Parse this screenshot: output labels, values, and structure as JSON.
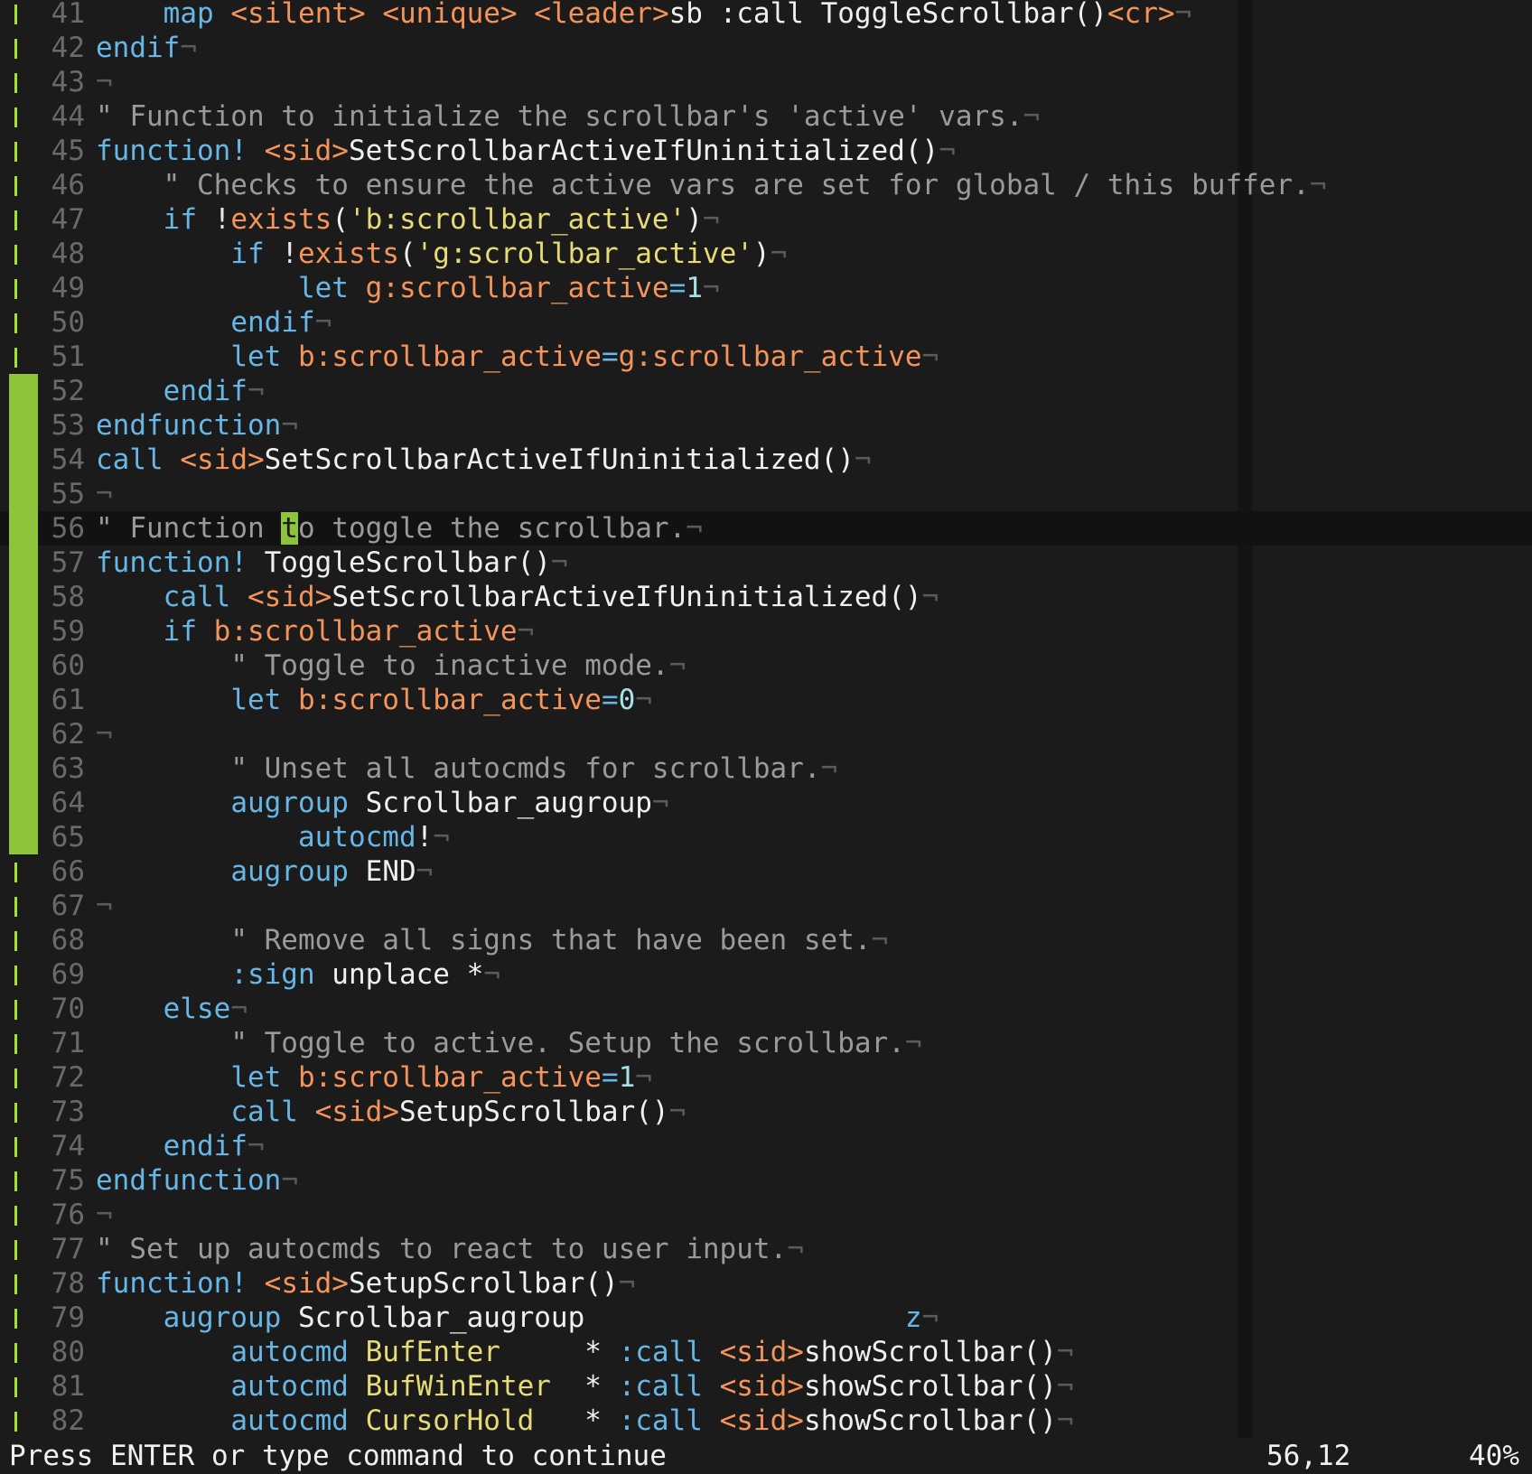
{
  "editor": {
    "lines": [
      {
        "num": "41",
        "sign": "bar",
        "segs": [
          {
            "t": "    "
          },
          {
            "c": "k",
            "t": "map"
          },
          {
            "t": " "
          },
          {
            "c": "v",
            "t": "<silent>"
          },
          {
            "t": " "
          },
          {
            "c": "v",
            "t": "<unique>"
          },
          {
            "t": " "
          },
          {
            "c": "v",
            "t": "<leader>"
          },
          {
            "t": "sb :call ToggleScrollbar()"
          },
          {
            "c": "v",
            "t": "<cr>"
          },
          {
            "c": "eol",
            "t": "¬"
          }
        ]
      },
      {
        "num": "42",
        "sign": "bar",
        "segs": [
          {
            "c": "k",
            "t": "endif"
          },
          {
            "c": "eol",
            "t": "¬"
          }
        ]
      },
      {
        "num": "43",
        "sign": "bar",
        "segs": [
          {
            "c": "eol",
            "t": "¬"
          }
        ]
      },
      {
        "num": "44",
        "sign": "bar",
        "segs": [
          {
            "c": "c",
            "t": "\" Function to initialize the scrollbar's 'active' vars."
          },
          {
            "c": "eol",
            "t": "¬"
          }
        ]
      },
      {
        "num": "45",
        "sign": "bar",
        "segs": [
          {
            "c": "k",
            "t": "function!"
          },
          {
            "t": " "
          },
          {
            "c": "v",
            "t": "<sid>"
          },
          {
            "t": "SetScrollbarActiveIfUninitialized()"
          },
          {
            "c": "eol",
            "t": "¬"
          }
        ]
      },
      {
        "num": "46",
        "sign": "bar",
        "segs": [
          {
            "t": "    "
          },
          {
            "c": "c",
            "t": "\" Checks to ensure the active vars are set for global / this buffer."
          },
          {
            "c": "eol",
            "t": "¬"
          }
        ]
      },
      {
        "num": "47",
        "sign": "bar",
        "segs": [
          {
            "t": "    "
          },
          {
            "c": "k",
            "t": "if"
          },
          {
            "t": " "
          },
          {
            "c": "o",
            "t": "!"
          },
          {
            "c": "v",
            "t": "exists"
          },
          {
            "t": "("
          },
          {
            "c": "s",
            "t": "'b:scrollbar_active'"
          },
          {
            "t": ")"
          },
          {
            "c": "eol",
            "t": "¬"
          }
        ]
      },
      {
        "num": "48",
        "sign": "bar",
        "segs": [
          {
            "t": "        "
          },
          {
            "c": "k",
            "t": "if"
          },
          {
            "t": " "
          },
          {
            "c": "o",
            "t": "!"
          },
          {
            "c": "v",
            "t": "exists"
          },
          {
            "t": "("
          },
          {
            "c": "s",
            "t": "'g:scrollbar_active'"
          },
          {
            "t": ")"
          },
          {
            "c": "eol",
            "t": "¬"
          }
        ]
      },
      {
        "num": "49",
        "sign": "bar",
        "segs": [
          {
            "t": "            "
          },
          {
            "c": "k",
            "t": "let"
          },
          {
            "t": " "
          },
          {
            "c": "v",
            "t": "g:scrollbar_active"
          },
          {
            "c": "k",
            "t": "="
          },
          {
            "c": "n",
            "t": "1"
          },
          {
            "c": "eol",
            "t": "¬"
          }
        ]
      },
      {
        "num": "50",
        "sign": "bar",
        "segs": [
          {
            "t": "        "
          },
          {
            "c": "k",
            "t": "endif"
          },
          {
            "c": "eol",
            "t": "¬"
          }
        ]
      },
      {
        "num": "51",
        "sign": "bar",
        "segs": [
          {
            "t": "        "
          },
          {
            "c": "k",
            "t": "let"
          },
          {
            "t": " "
          },
          {
            "c": "v",
            "t": "b:scrollbar_active"
          },
          {
            "c": "k",
            "t": "="
          },
          {
            "c": "v",
            "t": "g:scrollbar_active"
          },
          {
            "c": "eol",
            "t": "¬"
          }
        ]
      },
      {
        "num": "52",
        "sign": "block",
        "segs": [
          {
            "t": "    "
          },
          {
            "c": "k",
            "t": "endif"
          },
          {
            "c": "eol",
            "t": "¬"
          }
        ]
      },
      {
        "num": "53",
        "sign": "block",
        "segs": [
          {
            "c": "k",
            "t": "endfunction"
          },
          {
            "c": "eol",
            "t": "¬"
          }
        ]
      },
      {
        "num": "54",
        "sign": "block",
        "segs": [
          {
            "c": "k",
            "t": "call"
          },
          {
            "t": " "
          },
          {
            "c": "v",
            "t": "<sid>"
          },
          {
            "t": "SetScrollbarActiveIfUninitialized()"
          },
          {
            "c": "eol",
            "t": "¬"
          }
        ]
      },
      {
        "num": "55",
        "sign": "block",
        "segs": [
          {
            "c": "eol",
            "t": "¬"
          }
        ]
      },
      {
        "num": "56",
        "sign": "block",
        "cursorline": true,
        "segs": [
          {
            "c": "c",
            "t": "\" Function "
          },
          {
            "c": "cur",
            "t": "t"
          },
          {
            "c": "c",
            "t": "o toggle the scrollbar."
          },
          {
            "c": "eol",
            "t": "¬"
          }
        ]
      },
      {
        "num": "57",
        "sign": "block",
        "segs": [
          {
            "c": "k",
            "t": "function!"
          },
          {
            "t": " ToggleScrollbar()"
          },
          {
            "c": "eol",
            "t": "¬"
          }
        ]
      },
      {
        "num": "58",
        "sign": "block",
        "segs": [
          {
            "t": "    "
          },
          {
            "c": "k",
            "t": "call"
          },
          {
            "t": " "
          },
          {
            "c": "v",
            "t": "<sid>"
          },
          {
            "t": "SetScrollbarActiveIfUninitialized()"
          },
          {
            "c": "eol",
            "t": "¬"
          }
        ]
      },
      {
        "num": "59",
        "sign": "block",
        "segs": [
          {
            "t": "    "
          },
          {
            "c": "k",
            "t": "if"
          },
          {
            "t": " "
          },
          {
            "c": "v",
            "t": "b:scrollbar_active"
          },
          {
            "c": "eol",
            "t": "¬"
          }
        ]
      },
      {
        "num": "60",
        "sign": "block",
        "segs": [
          {
            "t": "        "
          },
          {
            "c": "c",
            "t": "\" Toggle to inactive mode."
          },
          {
            "c": "eol",
            "t": "¬"
          }
        ]
      },
      {
        "num": "61",
        "sign": "block",
        "segs": [
          {
            "t": "        "
          },
          {
            "c": "k",
            "t": "let"
          },
          {
            "t": " "
          },
          {
            "c": "v",
            "t": "b:scrollbar_active"
          },
          {
            "c": "k",
            "t": "="
          },
          {
            "c": "n",
            "t": "0"
          },
          {
            "c": "eol",
            "t": "¬"
          }
        ]
      },
      {
        "num": "62",
        "sign": "block",
        "segs": [
          {
            "c": "eol",
            "t": "¬"
          }
        ]
      },
      {
        "num": "63",
        "sign": "block",
        "segs": [
          {
            "t": "        "
          },
          {
            "c": "c",
            "t": "\" Unset all autocmds for scrollbar."
          },
          {
            "c": "eol",
            "t": "¬"
          }
        ]
      },
      {
        "num": "64",
        "sign": "block",
        "segs": [
          {
            "t": "        "
          },
          {
            "c": "k",
            "t": "augroup"
          },
          {
            "t": " Scrollbar_augroup"
          },
          {
            "c": "eol",
            "t": "¬"
          }
        ]
      },
      {
        "num": "65",
        "sign": "block",
        "segs": [
          {
            "t": "            "
          },
          {
            "c": "k",
            "t": "autocmd"
          },
          {
            "t": "!"
          },
          {
            "c": "eol",
            "t": "¬"
          }
        ]
      },
      {
        "num": "66",
        "sign": "bar",
        "segs": [
          {
            "t": "        "
          },
          {
            "c": "k",
            "t": "augroup"
          },
          {
            "t": " END"
          },
          {
            "c": "eol",
            "t": "¬"
          }
        ]
      },
      {
        "num": "67",
        "sign": "bar",
        "segs": [
          {
            "c": "eol",
            "t": "¬"
          }
        ]
      },
      {
        "num": "68",
        "sign": "bar",
        "segs": [
          {
            "t": "        "
          },
          {
            "c": "c",
            "t": "\" Remove all signs that have been set."
          },
          {
            "c": "eol",
            "t": "¬"
          }
        ]
      },
      {
        "num": "69",
        "sign": "bar",
        "segs": [
          {
            "t": "        "
          },
          {
            "c": "k",
            "t": ":sign"
          },
          {
            "t": " unplace *"
          },
          {
            "c": "eol",
            "t": "¬"
          }
        ]
      },
      {
        "num": "70",
        "sign": "bar",
        "segs": [
          {
            "t": "    "
          },
          {
            "c": "k",
            "t": "else"
          },
          {
            "c": "eol",
            "t": "¬"
          }
        ]
      },
      {
        "num": "71",
        "sign": "bar",
        "segs": [
          {
            "t": "        "
          },
          {
            "c": "c",
            "t": "\" Toggle to active. Setup the scrollbar."
          },
          {
            "c": "eol",
            "t": "¬"
          }
        ]
      },
      {
        "num": "72",
        "sign": "bar",
        "segs": [
          {
            "t": "        "
          },
          {
            "c": "k",
            "t": "let"
          },
          {
            "t": " "
          },
          {
            "c": "v",
            "t": "b:scrollbar_active"
          },
          {
            "c": "k",
            "t": "="
          },
          {
            "c": "n",
            "t": "1"
          },
          {
            "c": "eol",
            "t": "¬"
          }
        ]
      },
      {
        "num": "73",
        "sign": "bar",
        "segs": [
          {
            "t": "        "
          },
          {
            "c": "k",
            "t": "call"
          },
          {
            "t": " "
          },
          {
            "c": "v",
            "t": "<sid>"
          },
          {
            "t": "SetupScrollbar()"
          },
          {
            "c": "eol",
            "t": "¬"
          }
        ]
      },
      {
        "num": "74",
        "sign": "bar",
        "segs": [
          {
            "t": "    "
          },
          {
            "c": "k",
            "t": "endif"
          },
          {
            "c": "eol",
            "t": "¬"
          }
        ]
      },
      {
        "num": "75",
        "sign": "bar",
        "segs": [
          {
            "c": "k",
            "t": "endfunction"
          },
          {
            "c": "eol",
            "t": "¬"
          }
        ]
      },
      {
        "num": "76",
        "sign": "bar",
        "segs": [
          {
            "c": "eol",
            "t": "¬"
          }
        ]
      },
      {
        "num": "77",
        "sign": "bar",
        "segs": [
          {
            "c": "c",
            "t": "\" Set up autocmds to react to user input."
          },
          {
            "c": "eol",
            "t": "¬"
          }
        ]
      },
      {
        "num": "78",
        "sign": "bar",
        "segs": [
          {
            "c": "k",
            "t": "function!"
          },
          {
            "t": " "
          },
          {
            "c": "v",
            "t": "<sid>"
          },
          {
            "t": "SetupScrollbar()"
          },
          {
            "c": "eol",
            "t": "¬"
          }
        ]
      },
      {
        "num": "79",
        "sign": "bar",
        "segs": [
          {
            "t": "    "
          },
          {
            "c": "k",
            "t": "augroup"
          },
          {
            "t": " Scrollbar_augroup                   "
          },
          {
            "c": "k",
            "t": "z"
          },
          {
            "c": "eol",
            "t": "¬"
          }
        ]
      },
      {
        "num": "80",
        "sign": "bar",
        "segs": [
          {
            "t": "        "
          },
          {
            "c": "k",
            "t": "autocmd"
          },
          {
            "t": " "
          },
          {
            "c": "s",
            "t": "BufEnter"
          },
          {
            "t": "     * "
          },
          {
            "c": "k",
            "t": ":call"
          },
          {
            "t": " "
          },
          {
            "c": "v",
            "t": "<sid>"
          },
          {
            "t": "showScrollbar()"
          },
          {
            "c": "eol",
            "t": "¬"
          }
        ]
      },
      {
        "num": "81",
        "sign": "bar",
        "segs": [
          {
            "t": "        "
          },
          {
            "c": "k",
            "t": "autocmd"
          },
          {
            "t": " "
          },
          {
            "c": "s",
            "t": "BufWinEnter"
          },
          {
            "t": "  * "
          },
          {
            "c": "k",
            "t": ":call"
          },
          {
            "t": " "
          },
          {
            "c": "v",
            "t": "<sid>"
          },
          {
            "t": "showScrollbar()"
          },
          {
            "c": "eol",
            "t": "¬"
          }
        ]
      },
      {
        "num": "82",
        "sign": "bar",
        "segs": [
          {
            "t": "        "
          },
          {
            "c": "k",
            "t": "autocmd"
          },
          {
            "t": " "
          },
          {
            "c": "s",
            "t": "CursorHold"
          },
          {
            "t": "   * "
          },
          {
            "c": "k",
            "t": ":call"
          },
          {
            "t": " "
          },
          {
            "c": "v",
            "t": "<sid>"
          },
          {
            "t": "showScrollbar()"
          },
          {
            "c": "eol",
            "t": "¬"
          }
        ]
      }
    ]
  },
  "status": {
    "message": "Press ENTER or type command to continue",
    "position": "56,12",
    "percent": "40%"
  },
  "colors": {
    "background": "#1b1b1b",
    "sign_green": "#8dc43a",
    "keyword": "#66b6e6",
    "comment": "#9a9a9a",
    "string": "#e6db74",
    "variable": "#f5945a"
  }
}
